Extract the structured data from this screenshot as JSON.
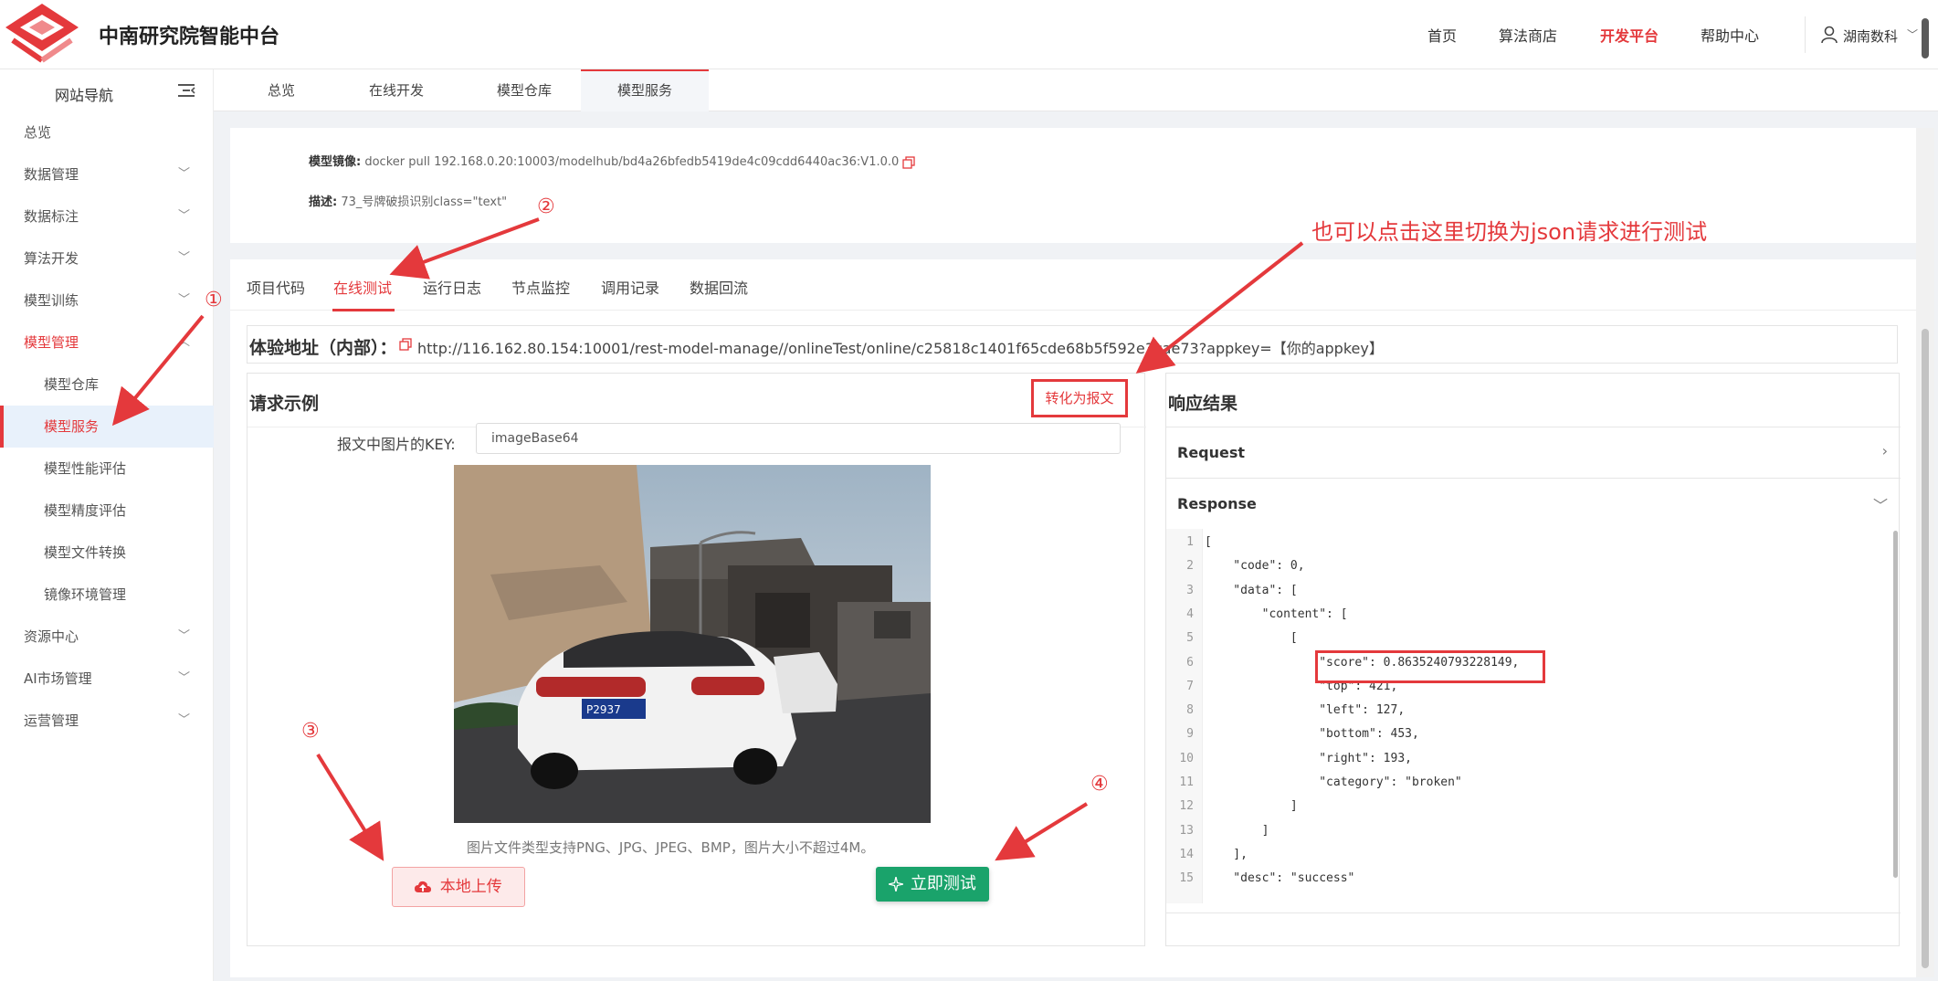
{
  "header": {
    "brand": "中南研究院智能中台",
    "nav": [
      "首页",
      "算法商店",
      "开发平台",
      "帮助中心"
    ],
    "active_nav": "开发平台",
    "user": "湖南数科"
  },
  "sidebar": {
    "title": "网站导航",
    "items": [
      {
        "label": "总览"
      },
      {
        "label": "数据管理"
      },
      {
        "label": "数据标注"
      },
      {
        "label": "算法开发"
      },
      {
        "label": "模型训练"
      },
      {
        "label": "模型管理"
      },
      {
        "label": "模型仓库"
      },
      {
        "label": "模型服务"
      },
      {
        "label": "模型性能评估"
      },
      {
        "label": "模型精度评估"
      },
      {
        "label": "模型文件转换"
      },
      {
        "label": "镜像环境管理"
      },
      {
        "label": "资源中心"
      },
      {
        "label": "AI市场管理"
      },
      {
        "label": "运营管理"
      }
    ]
  },
  "main_tabs": [
    "总览",
    "在线开发",
    "模型仓库",
    "模型服务"
  ],
  "info": {
    "image_label": "模型镜像:",
    "image_value": "docker pull 192.168.0.20:10003/modelhub/bd4a26bfedb5419de4c09cdd6440ac36:V1.0.0",
    "desc_label": "描述:",
    "desc_value": "73_号牌破损识别class=\"text\""
  },
  "sub_tabs": [
    "项目代码",
    "在线测试",
    "运行日志",
    "节点监控",
    "调用记录",
    "数据回流"
  ],
  "address": {
    "label": "体验地址（内部）：",
    "url": "http://116.162.80.154:10001/rest-model-manage//onlineTest/online/c25818c1401f65cde68b5f592e3cae73?appkey=【你的appkey】"
  },
  "request": {
    "title": "请求示例",
    "convert_button": "转化为报文",
    "key_label": "报文中图片的KEY:",
    "key_value": "imageBase64",
    "plate_text": "P2937",
    "hint": "图片文件类型支持PNG、JPG、JPEG、BMP，图片大小不超过4M。",
    "upload_button": "本地上传",
    "test_button": "立即测试"
  },
  "response": {
    "title": "响应结果",
    "request_label": "Request",
    "response_label": "Response",
    "code_lines": [
      "[",
      "    \"code\": 0,",
      "    \"data\": [",
      "        \"content\": [",
      "            [",
      "                \"score\": 0.8635240793228149,",
      "                \"top\": 421,",
      "                \"left\": 127,",
      "                \"bottom\": 453,",
      "                \"right\": 193,",
      "                \"category\": \"broken\"",
      "            ]",
      "        ]",
      "    ],",
      "    \"desc\": \"success\""
    ]
  },
  "annotations": {
    "circle_1": "①",
    "circle_2": "②",
    "circle_3": "③",
    "circle_4": "④",
    "note": "也可以点击这里切换为json请求进行测试"
  },
  "colors": {
    "accent_red": "#e4393c",
    "success_green": "#1aa36b"
  }
}
